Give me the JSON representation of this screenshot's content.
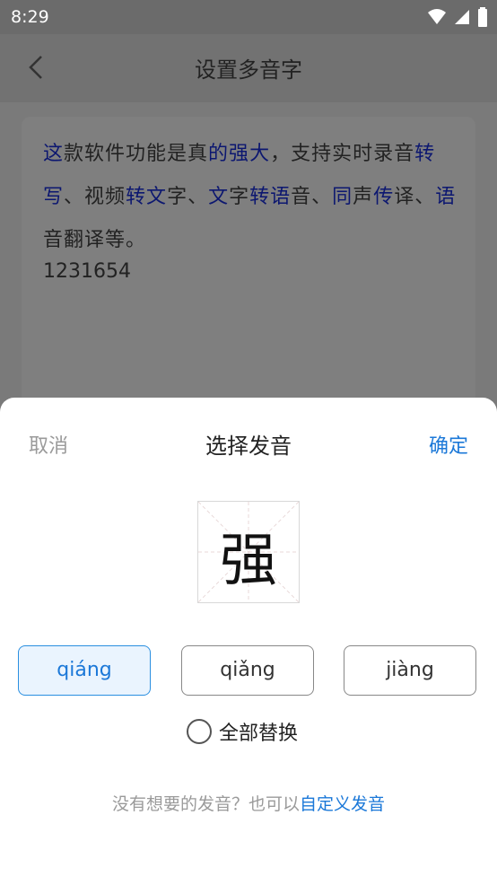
{
  "status_bar": {
    "time": "8:29"
  },
  "header": {
    "title": "设置多音字"
  },
  "content": {
    "segments": [
      {
        "t": "这",
        "p": true
      },
      {
        "t": "款软件功能是真",
        "p": false
      },
      {
        "t": "的",
        "p": true
      },
      {
        "t": "强",
        "p": true
      },
      {
        "t": "大",
        "p": true
      },
      {
        "t": "，支持实时录音",
        "p": false
      },
      {
        "t": "转",
        "p": true
      },
      {
        "t": "写",
        "p": true
      },
      {
        "t": "、视频",
        "p": false
      },
      {
        "t": "转",
        "p": true
      },
      {
        "t": "文",
        "p": true
      },
      {
        "t": "字、",
        "p": false
      },
      {
        "t": "文",
        "p": true
      },
      {
        "t": "字",
        "p": false
      },
      {
        "t": "转",
        "p": true
      },
      {
        "t": "语",
        "p": true
      },
      {
        "t": "音、",
        "p": false
      },
      {
        "t": "同",
        "p": true
      },
      {
        "t": "声",
        "p": false
      },
      {
        "t": "传",
        "p": true
      },
      {
        "t": "译、",
        "p": false
      },
      {
        "t": "语",
        "p": true
      },
      {
        "t": "音翻译等。",
        "p": false
      }
    ],
    "number_line": "1231654"
  },
  "sheet": {
    "cancel": "取消",
    "title": "选择发音",
    "confirm": "确定",
    "character": "强",
    "options": [
      "qiáng",
      "qiǎng",
      "jiàng"
    ],
    "selected_index": 0,
    "replace_all": "全部替换",
    "hint_prefix": "没有想要的发音？也可以",
    "hint_link": "自定义发音"
  },
  "colors": {
    "accent": "#1b78d8",
    "polyphonic": "#0c1770"
  }
}
